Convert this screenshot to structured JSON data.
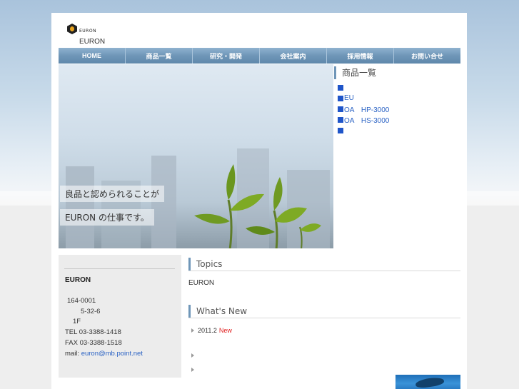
{
  "header": {
    "logo_text": "EURON",
    "site_name": "EURON"
  },
  "nav": [
    {
      "label": "HOME"
    },
    {
      "label": "商品一覧"
    },
    {
      "label": "研究・開発"
    },
    {
      "label": "会社案内"
    },
    {
      "label": "採用情報"
    },
    {
      "label": "お問い合せ"
    }
  ],
  "hero": {
    "caption_line1": "良品と認められることが",
    "caption_line2": "EURON の仕事です。"
  },
  "products": {
    "title": "商品一覧",
    "items": [
      {
        "label": ""
      },
      {
        "label": "EU"
      },
      {
        "label": "OA　HP-3000"
      },
      {
        "label": "OA　HS-3000"
      },
      {
        "label": ""
      }
    ]
  },
  "company_info": {
    "name": "EURON",
    "postal": "164-0001",
    "address_line1": "5-32-6",
    "address_line2": "1F",
    "tel": "TEL 03-3388-1418",
    "fax": "FAX 03-3388-1518",
    "mail_label": "mail: ",
    "mail": "euron@mb.point.net"
  },
  "topics": {
    "title": "Topics",
    "text": "EURON"
  },
  "whats_new": {
    "title": "What's New",
    "items": [
      {
        "date": "2011.2",
        "badge": "New"
      },
      {
        "date": "",
        "badge": ""
      },
      {
        "date": "",
        "badge": ""
      }
    ]
  },
  "colors": {
    "nav": "#6f96b8",
    "link": "#2a62c4",
    "bullet": "#1f55c9",
    "new_badge": "#e02020"
  }
}
